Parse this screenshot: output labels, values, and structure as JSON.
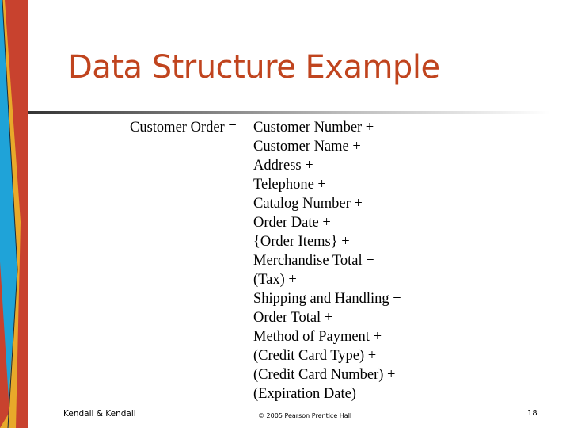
{
  "slide": {
    "title": "Data Structure Example",
    "definition": {
      "lhs": "Customer Order =",
      "rhs": [
        "Customer Number +",
        "Customer Name +",
        "Address +",
        "Telephone +",
        "Catalog Number +",
        "Order Date +",
        "{Order Items} +",
        "Merchandise Total +",
        "(Tax) +",
        "Shipping and Handling +",
        "Order Total +",
        "Method of Payment +",
        "(Credit Card Type) +",
        "(Credit Card Number) +",
        "(Expiration Date)"
      ]
    },
    "footer": {
      "left": "Kendall & Kendall",
      "center": "© 2005 Pearson Prentice Hall",
      "page_number": "18"
    }
  },
  "theme": {
    "title_color": "#c0441e",
    "sidebar_colors": [
      "#c8422e",
      "#e8a92a",
      "#1fa3d8"
    ]
  }
}
